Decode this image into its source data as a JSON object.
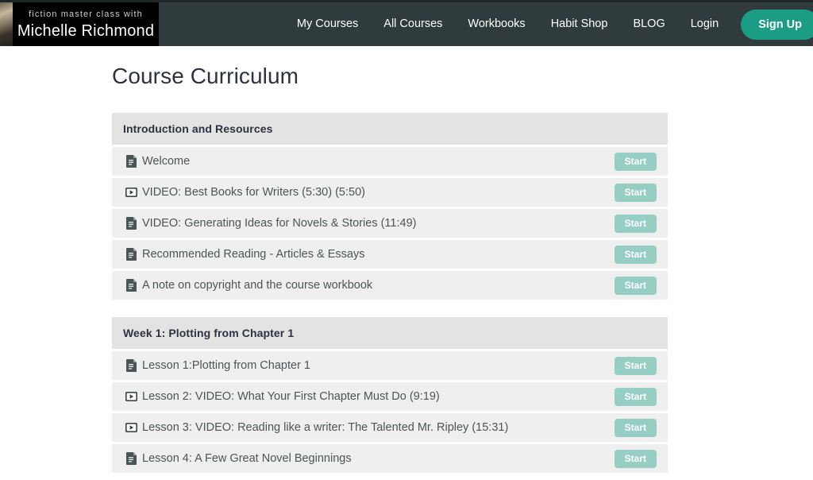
{
  "header": {
    "brand": {
      "kicker": "fiction master class with",
      "name": "Michelle Richmond",
      "photo_alt": "author-photo"
    },
    "nav_links": [
      {
        "label": "My Courses"
      },
      {
        "label": "All Courses"
      },
      {
        "label": "Workbooks"
      },
      {
        "label": "Habit Shop"
      },
      {
        "label": "BLOG"
      },
      {
        "label": "Login"
      }
    ],
    "signup_label": "Sign Up",
    "colors": {
      "navbar_bg": "#2f3b3c",
      "brand_bg": "#000000",
      "signup_bg": "#1b9d85"
    }
  },
  "main": {
    "page_title": "Course Curriculum",
    "start_label": "Start",
    "colors": {
      "section_header_bg": "#e3e3e3",
      "row_bg": "#efefef",
      "start_button_bg": "#96cec4",
      "row_text": "#4b5557"
    },
    "sections": [
      {
        "title": "Introduction and Resources",
        "items": [
          {
            "icon": "document-icon",
            "label": "Welcome",
            "action": "Start"
          },
          {
            "icon": "video-icon",
            "label": "VIDEO: Best Books for Writers (5:30) (5:50)",
            "action": "Start"
          },
          {
            "icon": "document-icon",
            "label": "VIDEO: Generating Ideas for Novels & Stories (11:49)",
            "action": "Start"
          },
          {
            "icon": "document-icon",
            "label": "Recommended Reading - Articles & Essays",
            "action": "Start"
          },
          {
            "icon": "document-icon",
            "label": "A note on copyright and the course workbook",
            "action": "Start"
          }
        ]
      },
      {
        "title": "Week 1: Plotting from Chapter 1",
        "items": [
          {
            "icon": "document-icon",
            "label": "Lesson 1:Plotting from Chapter 1",
            "action": "Start"
          },
          {
            "icon": "video-icon",
            "label": "Lesson 2: VIDEO: What Your First Chapter Must Do (9:19)",
            "action": "Start"
          },
          {
            "icon": "video-icon",
            "label": "Lesson 3: VIDEO: Reading like a writer: The Talented Mr. Ripley (15:31)",
            "action": "Start"
          },
          {
            "icon": "document-icon",
            "label": "Lesson 4: A Few Great Novel Beginnings",
            "action": "Start"
          }
        ]
      }
    ]
  }
}
